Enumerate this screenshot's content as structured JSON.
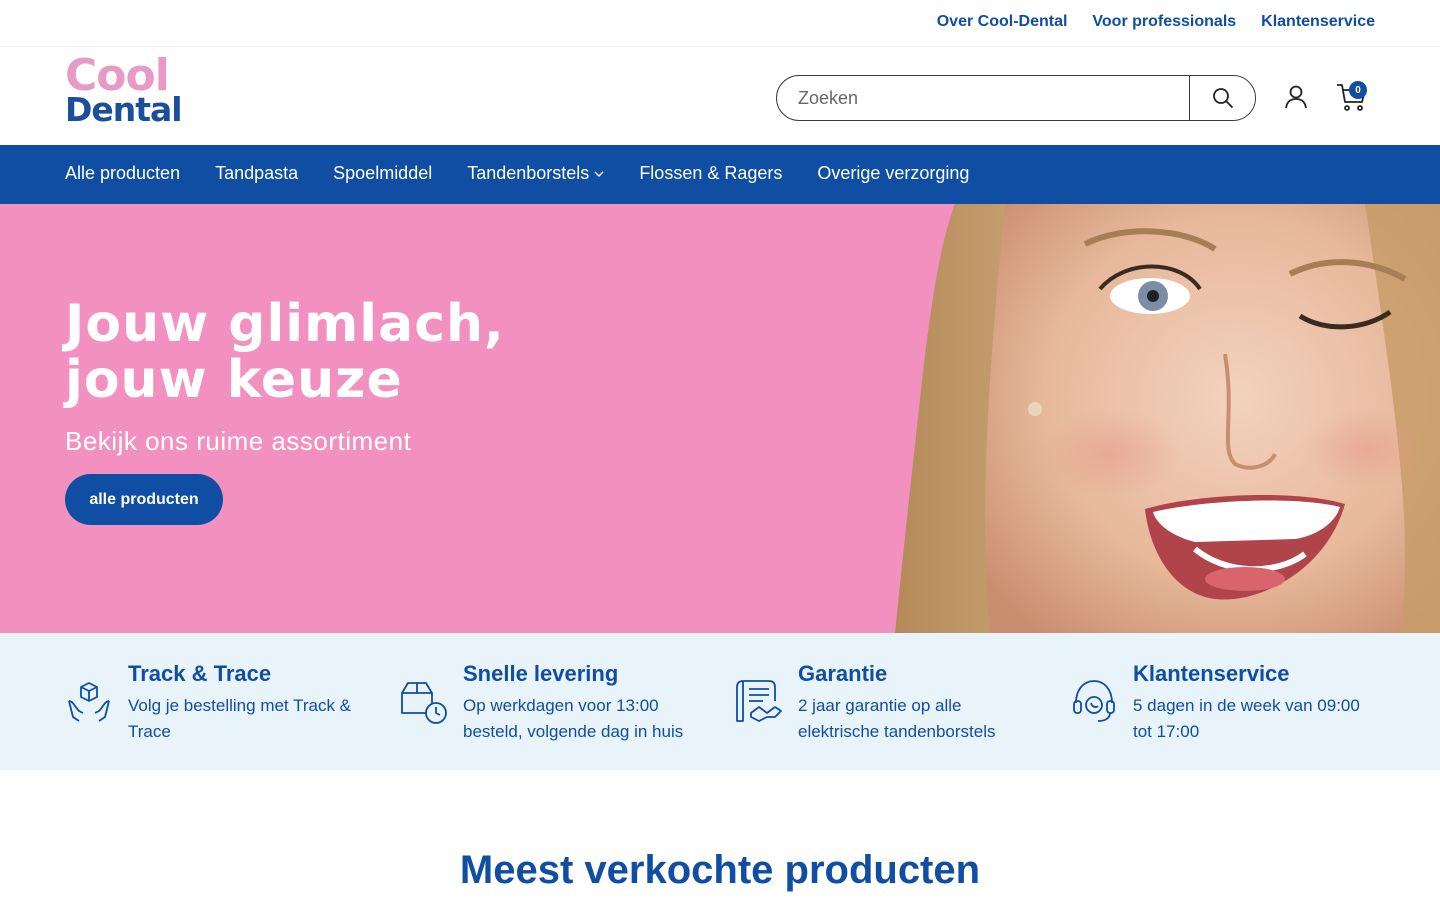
{
  "topbar": {
    "links": [
      "Over Cool-Dental",
      "Voor professionals",
      "Klantenservice"
    ]
  },
  "header": {
    "logo_line1": "Cool",
    "logo_line2": "Dental",
    "search_placeholder": "Zoeken",
    "cart_count": "0"
  },
  "nav": {
    "items": [
      "Alle producten",
      "Tandpasta",
      "Spoelmiddel",
      "Tandenborstels",
      "Flossen & Ragers",
      "Overige verzorging"
    ]
  },
  "hero": {
    "title_line1": "Jouw glimlach,",
    "title_line2": "jouw keuze",
    "subtitle": "Bekijk ons ruime assortiment",
    "button_label": "alle producten",
    "background_color": "#f291bf"
  },
  "usps": [
    {
      "icon": "track-trace-icon",
      "title": "Track & Trace",
      "text": "Volg je bestelling met Track & Trace"
    },
    {
      "icon": "delivery-clock-icon",
      "title": "Snelle levering",
      "text": "Op werkdagen voor 13:00 besteld, volgende dag in huis"
    },
    {
      "icon": "warranty-icon",
      "title": "Garantie",
      "text": "2 jaar garantie op alle elektrische tandenborstels"
    },
    {
      "icon": "headset-icon",
      "title": "Klantenservice",
      "text": "5 dagen in de week van 09:00 tot 17:00"
    }
  ],
  "section": {
    "title": "Meest verkochte producten"
  },
  "colors": {
    "brand_blue": "#0f4ea3",
    "brand_pink": "#e79ac3",
    "usp_bg": "#e9f3fa"
  }
}
